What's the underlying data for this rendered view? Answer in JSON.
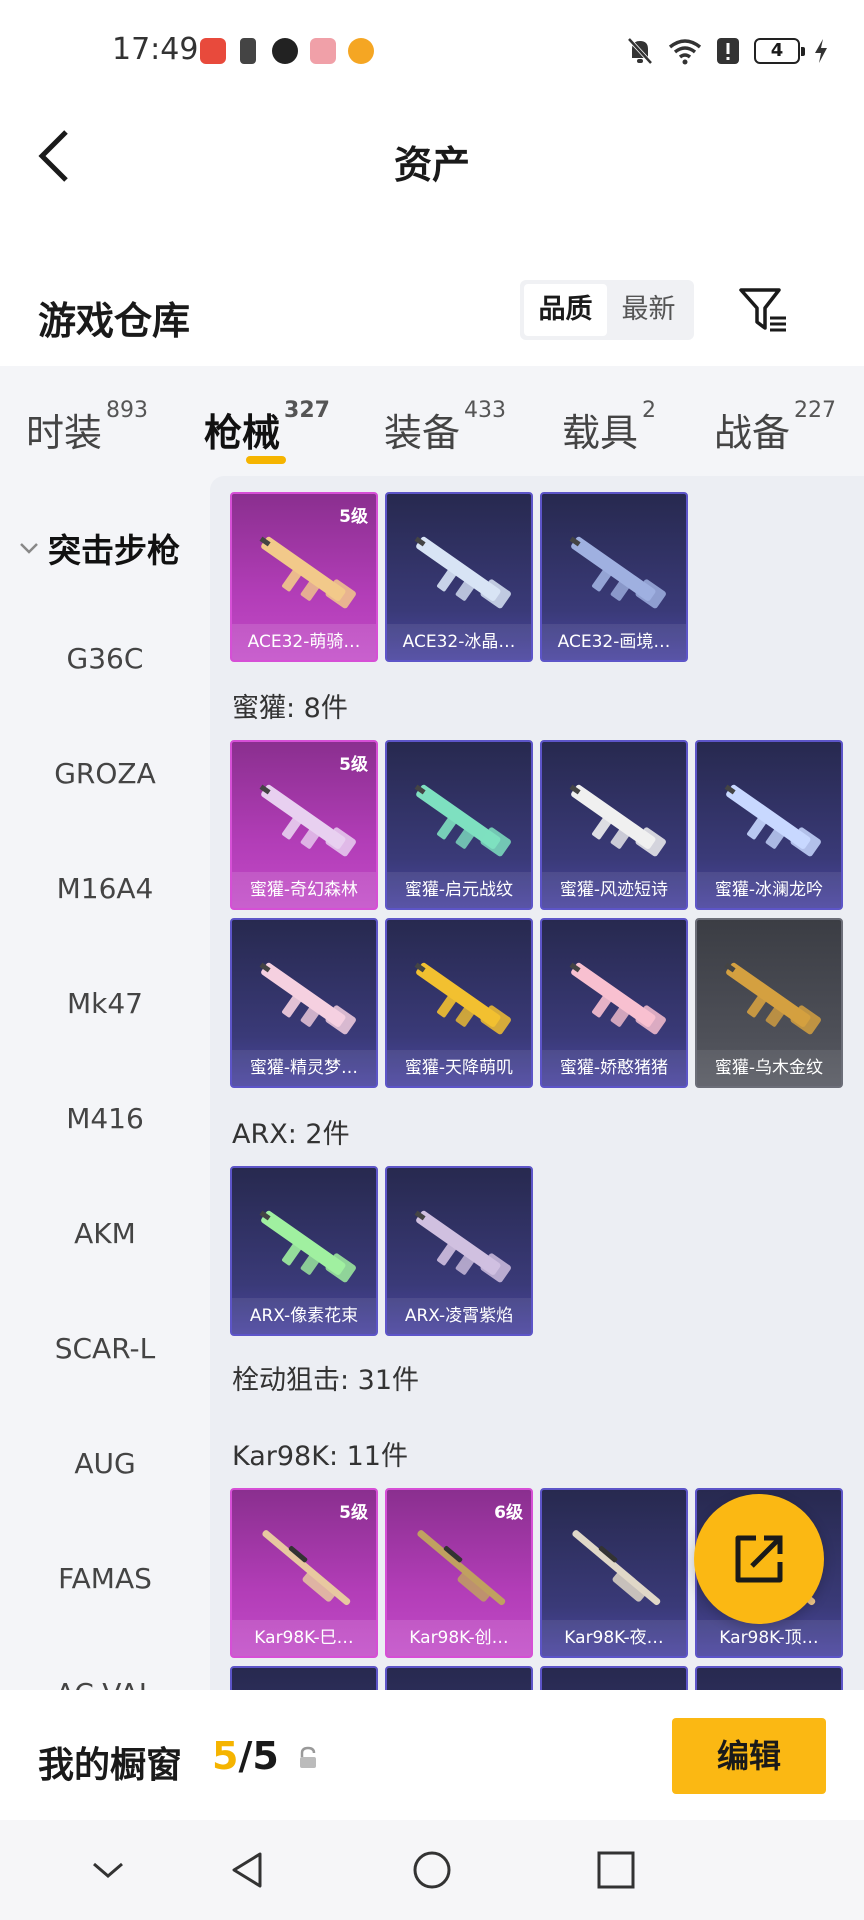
{
  "status_bar": {
    "time": "17:49",
    "battery": "4"
  },
  "header": {
    "title": "资产"
  },
  "warehouse": {
    "title": "游戏仓库",
    "sort_options": [
      "品质",
      "最新"
    ]
  },
  "tabs": [
    {
      "label": "时装",
      "count": "893"
    },
    {
      "label": "枪械",
      "count": "327"
    },
    {
      "label": "装备",
      "count": "433"
    },
    {
      "label": "载具",
      "count": "2"
    },
    {
      "label": "战备",
      "count": "227"
    }
  ],
  "sidebar": {
    "group": "突击步枪",
    "items": [
      "G36C",
      "GROZA",
      "M16A4",
      "Mk47",
      "M416",
      "AKM",
      "SCAR-L",
      "AUG",
      "FAMAS",
      "AC-VAL"
    ]
  },
  "sections": {
    "ace": {
      "cards": [
        {
          "name": "ACE32-萌骑…",
          "level": "5级",
          "rarity": "purple"
        },
        {
          "name": "ACE32-冰晶…",
          "level": "",
          "rarity": "blue"
        },
        {
          "name": "ACE32-画境…",
          "level": "",
          "rarity": "blue"
        }
      ]
    },
    "honey": {
      "label": "蜜獾: 8件",
      "cards": [
        {
          "name": "蜜獾-奇幻森林",
          "level": "5级",
          "rarity": "purple"
        },
        {
          "name": "蜜獾-启元战纹",
          "level": "",
          "rarity": "blue"
        },
        {
          "name": "蜜獾-风迹短诗",
          "level": "",
          "rarity": "blue"
        },
        {
          "name": "蜜獾-冰澜龙吟",
          "level": "",
          "rarity": "blue"
        },
        {
          "name": "蜜獾-精灵梦…",
          "level": "",
          "rarity": "blue"
        },
        {
          "name": "蜜獾-天降萌叽",
          "level": "",
          "rarity": "blue"
        },
        {
          "name": "蜜獾-娇憨猪猪",
          "level": "",
          "rarity": "blue"
        },
        {
          "name": "蜜獾-乌木金纹",
          "level": "",
          "rarity": "gray"
        }
      ]
    },
    "arx": {
      "label": "ARX: 2件",
      "cards": [
        {
          "name": "ARX-像素花束",
          "level": "",
          "rarity": "blue"
        },
        {
          "name": "ARX-凌霄紫焰",
          "level": "",
          "rarity": "blue"
        }
      ]
    },
    "sniper": {
      "label": "栓动狙击: 31件"
    },
    "kar": {
      "label": "Kar98K: 11件",
      "cards": [
        {
          "name": "Kar98K-巳…",
          "level": "5级",
          "rarity": "purple"
        },
        {
          "name": "Kar98K-创…",
          "level": "6级",
          "rarity": "purple"
        },
        {
          "name": "Kar98K-夜…",
          "level": "",
          "rarity": "blue"
        },
        {
          "name": "Kar98K-顶…",
          "level": "",
          "rarity": "blue"
        }
      ]
    }
  },
  "bottom": {
    "showcase_label": "我的橱窗",
    "showcase_used": "5",
    "showcase_total": "/5",
    "edit_label": "编辑"
  },
  "icons": {
    "back": "back-arrow-icon",
    "filter": "filter-icon",
    "share": "share-external-icon",
    "lock": "lock-icon"
  },
  "colors": {
    "accent": "#fbb813",
    "rare_purple": "#b23db7",
    "rare_blue": "#3a3a78",
    "rare_gray": "#4e5058"
  }
}
